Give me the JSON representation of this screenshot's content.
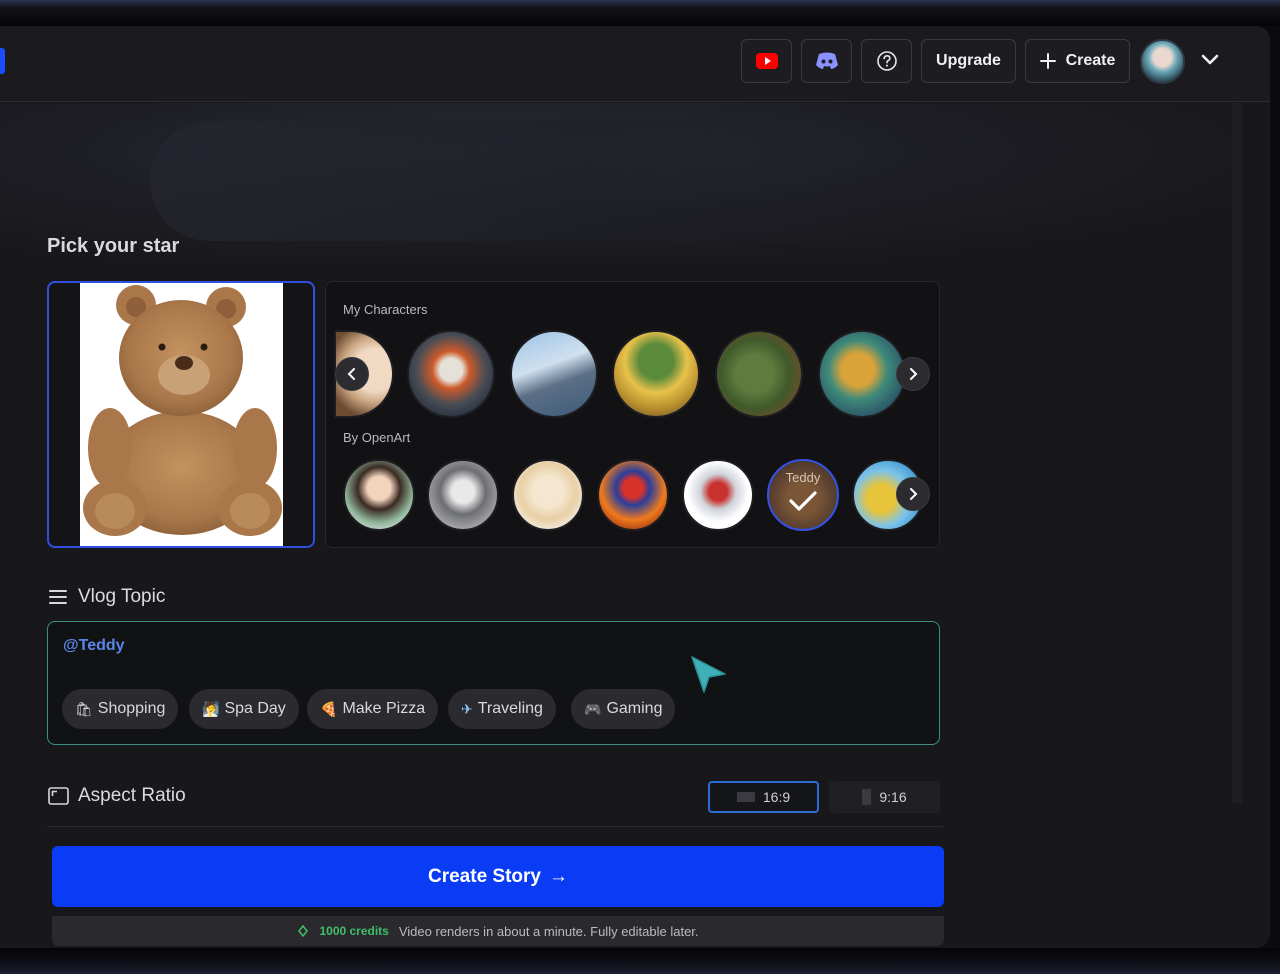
{
  "header": {
    "upgrade_label": "Upgrade",
    "create_label": "Create",
    "youtube_color": "#ff0000",
    "discord_color": "#5865f2"
  },
  "star": {
    "section_title": "Pick your star"
  },
  "characters": {
    "my_label": "My Characters",
    "openart_label": "By OpenArt",
    "selected_name": "Teddy"
  },
  "vlog": {
    "title": "Vlog Topic",
    "mention": "@Teddy",
    "chips": [
      {
        "icon": "🛍",
        "label": "Shopping"
      },
      {
        "icon": "🧖",
        "label": "Spa Day"
      },
      {
        "icon": "🍕",
        "label": "Make Pizza"
      },
      {
        "icon": "✈",
        "label": "Traveling"
      },
      {
        "icon": "🎮",
        "label": "Gaming"
      }
    ]
  },
  "aspect": {
    "title": "Aspect Ratio",
    "options": [
      "16:9",
      "9:16"
    ],
    "selected": "16:9"
  },
  "cta": {
    "label": "Create Story",
    "arrow": "→"
  },
  "credits": {
    "amount": "1000 credits",
    "note": "Video renders in about a minute. Fully editable later."
  },
  "colors": {
    "accent": "#0a3cf5",
    "selection_border": "#2f4fe0",
    "topic_border": "#3d8f85",
    "credits_green": "#3fbf6a"
  }
}
